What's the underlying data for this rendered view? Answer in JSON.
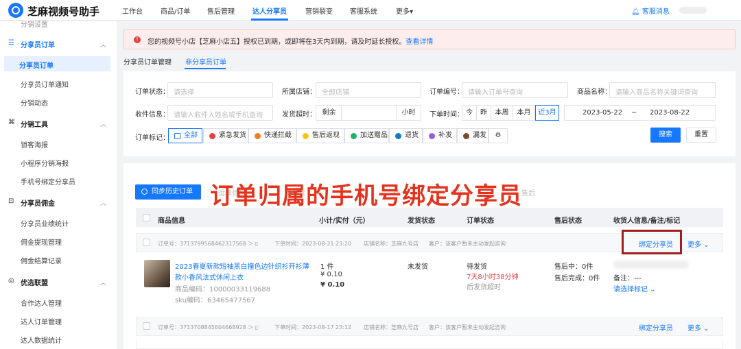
{
  "app": {
    "title": "芝麻视频号助手",
    "notice": "客服消息"
  },
  "nav": [
    "工作台",
    "商品/订单",
    "售后管理",
    "达人分享员",
    "营销裂变",
    "客服系统",
    "更多"
  ],
  "sidebar": {
    "cut": "分销设置",
    "g1": "分享员订单",
    "g1i": [
      "分享员订单",
      "分享员订单通知",
      "分销动态"
    ],
    "g2": "分销工具",
    "g2i": [
      "锁客海报",
      "小程序分销海报",
      "手机号绑定分享员"
    ],
    "g3": "分享员佣金",
    "g3i": [
      "分享员业绩统计",
      "佣金提现管理",
      "佣金结算记录"
    ],
    "g4": "优选联盟",
    "g4i": [
      "合作达人管理",
      "达人订单管理",
      "达人数据统计"
    ]
  },
  "alert": {
    "text": "您的视频号小店【芝麻小店五】授权已到期，或即将在3天内到期，请及时延长授权。",
    "link": "查看详情"
  },
  "tabs": [
    "分享员订单管理",
    "非分享员订单"
  ],
  "filter": {
    "status_label": "订单状态：",
    "status_ph": "请选择",
    "shop_label": "所属店铺：",
    "shop_ph": "全部店铺",
    "no_label": "订单编号：",
    "no_ph": "请输入订单号查询",
    "goods_label": "商品名称：",
    "goods_ph": "请输入商品名称关键词查询",
    "recv_label": "收件信息：",
    "recv_ph": "请输入收件人姓名或手机查询",
    "ship_label": "发货超时：",
    "ship_pre": "剩余",
    "ship_unit": "小时",
    "time_label": "下单时间：",
    "time_opts": [
      "今",
      "昨",
      "本周",
      "本月",
      "近3月"
    ],
    "date_from": "2023-05-22",
    "date_sep": "~",
    "date_to": "2023-08-22",
    "mark_label": "订单标记：",
    "marks": [
      {
        "label": "全部",
        "color": "#1677ff"
      },
      {
        "label": "紧急发货",
        "color": "#e84040"
      },
      {
        "label": "快递拦截",
        "color": "#f47b20"
      },
      {
        "label": "售后返现",
        "color": "#f5c518"
      },
      {
        "label": "加送赠品",
        "color": "#1bb46b"
      },
      {
        "label": "退货",
        "color": "#1677c8"
      },
      {
        "label": "补发",
        "color": "#8e5fd6"
      },
      {
        "label": "漏发",
        "color": "#7a4a2a"
      }
    ],
    "search": "搜索",
    "reset": "重置"
  },
  "list": {
    "sync": "同步历史订单",
    "ghost": [
      "运单",
      "信息",
      "待发货",
      "待",
      "审核",
      "售后"
    ],
    "overlay": "订单归属的手机号绑定分享员",
    "headers": [
      "商品信息",
      "小计/实付（元）",
      "发货状态",
      "订单状态",
      "售后状态",
      "收货人信息/备注/标记"
    ],
    "orders": [
      {
        "no_label": "订单号：",
        "no": "3713799568462317568",
        "time_label": "下单时间：",
        "time": "2023-08-21 23:20",
        "shop_label": "店铺名称：",
        "shop": "芝麻九号店",
        "cust": "客户：该客户暂未主动发起咨询",
        "bind": "绑定分享员",
        "more": "更多"
      },
      {
        "no_label": "订单号：",
        "no": "3713708845604668928",
        "time_label": "下单时间：",
        "time": "2023-08-17 23:12",
        "shop_label": "店铺名称：",
        "shop": "芝麻九号店",
        "cust": "客户：该客户暂未主动发起咨询",
        "bind": "绑定分享员",
        "more": "更多"
      }
    ],
    "item": {
      "title1": "2023春夏新款短袖黑白撞色边针织衫开衫薄",
      "title2": "款小香风法式休闲上衣",
      "code": "商品编码：10000033119688",
      "sku": "sku编码：63465477567",
      "qty": "1 件",
      "price": "¥ 0.10",
      "paid": "¥ 0.10",
      "ship": "未发货",
      "status": "待发货",
      "countdown": "7天8小时38分钟",
      "deadline": "后发货超时",
      "after1": "售后中：0件",
      "after2": "售后完成：0件",
      "remark": "备注：---",
      "mark": "请选择标记"
    }
  }
}
